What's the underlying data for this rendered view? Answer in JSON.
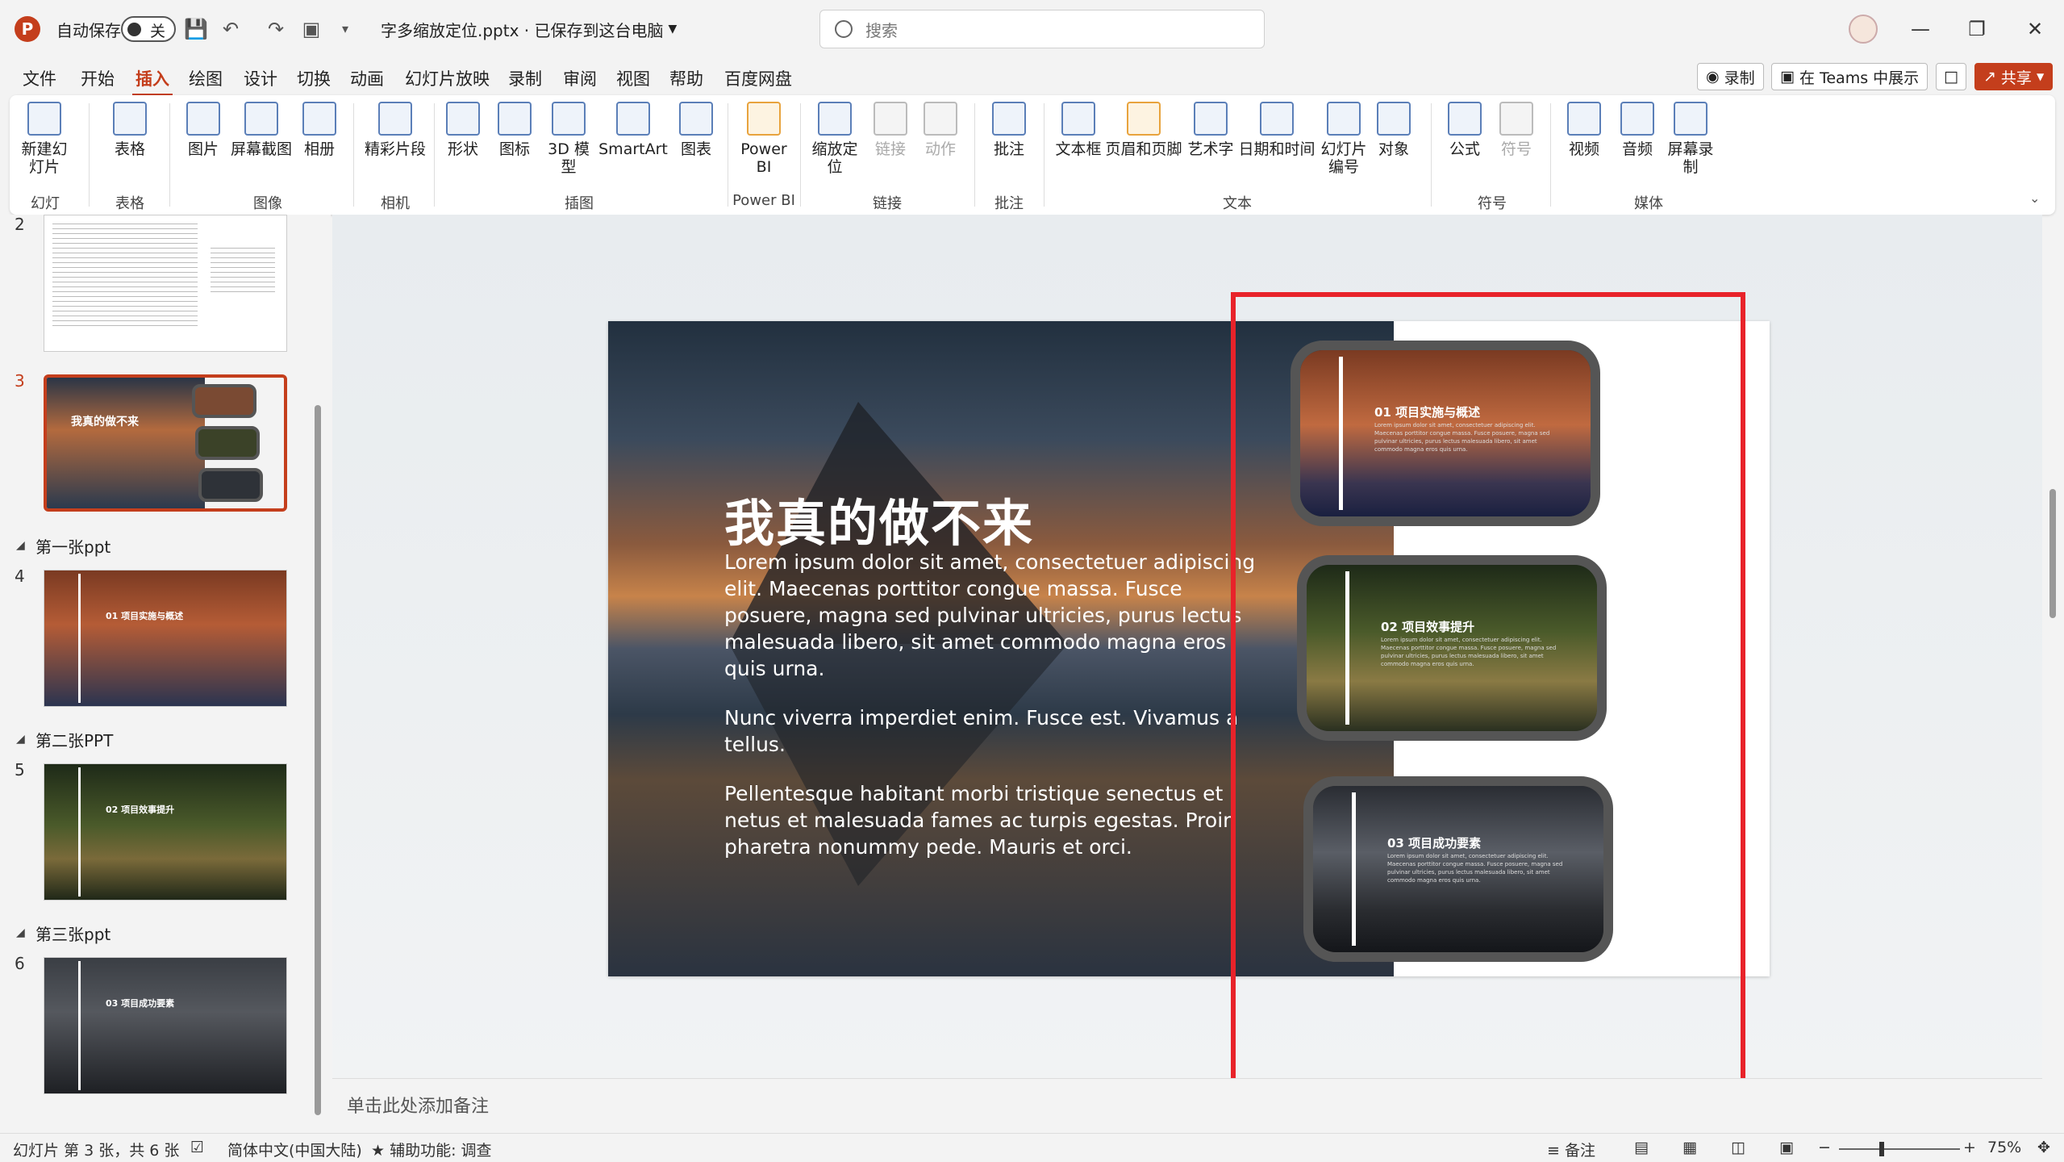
{
  "titlebar": {
    "autosave_label": "自动保存",
    "autosave_state": "关",
    "doc_title": "字多缩放定位.pptx · 已保存到这台电脑",
    "search_placeholder": "搜索"
  },
  "menu": {
    "items": [
      "文件",
      "开始",
      "插入",
      "绘图",
      "设计",
      "切换",
      "动画",
      "幻灯片放映",
      "录制",
      "审阅",
      "视图",
      "帮助",
      "百度网盘"
    ],
    "active": "插入",
    "record_btn": "录制",
    "teams_btn": "在 Teams 中展示",
    "share_btn": "共享"
  },
  "ribbon": {
    "buttons": {
      "new_slide": "新建幻灯片",
      "table": "表格",
      "picture": "图片",
      "screenshot": "屏幕截图",
      "album": "相册",
      "clip": "精彩片段",
      "shape": "形状",
      "icon": "图标",
      "model3d": "3D 模型",
      "smartart": "SmartArt",
      "chart": "图表",
      "powerbi": "Power BI",
      "zoom": "缩放定位",
      "link": "链接",
      "action": "动作",
      "comment": "批注",
      "textbox": "文本框",
      "header_footer": "页眉和页脚",
      "wordart": "艺术字",
      "datetime": "日期和时间",
      "slide_number": "幻灯片编号",
      "object": "对象",
      "equation": "公式",
      "symbol": "符号",
      "video": "视频",
      "audio": "音频",
      "screen_record": "屏幕录制"
    },
    "groups": {
      "slides": "幻灯片",
      "tables": "表格",
      "images": "图像",
      "camera": "相机",
      "illustrations": "插图",
      "powerbi": "Power BI",
      "links": "链接",
      "comments": "批注",
      "text": "文本",
      "symbols": "符号",
      "media": "媒体"
    }
  },
  "thumbnails": {
    "num2": "2",
    "num3": "3",
    "num4": "4",
    "num5": "5",
    "num6": "6",
    "section1": "第一张ppt",
    "section2": "第二张PPT",
    "section3": "第三张ppt",
    "thumb3_title": "我真的做不来",
    "thumb4_title": "01 项目实施与概述",
    "thumb5_title": "02 项目效事提升",
    "thumb6_title": "03 项目成功要素"
  },
  "slide": {
    "title": "我真的做不来",
    "para1": "Lorem ipsum dolor sit amet, consectetuer adipiscing elit. Maecenas porttitor congue massa. Fusce posuere, magna sed pulvinar ultricies, purus lectus malesuada libero, sit amet commodo magna eros quis urna.",
    "para2": "Nunc viverra imperdiet enim. Fusce est. Vivamus a tellus.",
    "para3": "Pellentesque habitant morbi tristique senectus et netus et malesuada fames ac turpis egestas. Proin pharetra nonummy pede. Mauris et orci.",
    "card1_title": "01 项目实施与概述",
    "card2_title": "02 项目效事提升",
    "card3_title": "03 项目成功要素",
    "card_body": "Lorem ipsum dolor sit amet, consectetuer adipiscing elit. Maecenas porttitor congue massa. Fusce posuere, magna sed pulvinar ultricies, purus lectus malesuada libero, sit amet commodo magna eros quis urna."
  },
  "notes": {
    "placeholder": "单击此处添加备注"
  },
  "status": {
    "slide_info": "幻灯片 第 3 张，共 6 张",
    "language": "简体中文(中国大陆)",
    "accessibility": "辅助功能: 调查",
    "notes_btn": "备注",
    "zoom": "75%"
  },
  "colors": {
    "accent": "#c43e1c",
    "highlight_box": "#e8232a"
  }
}
